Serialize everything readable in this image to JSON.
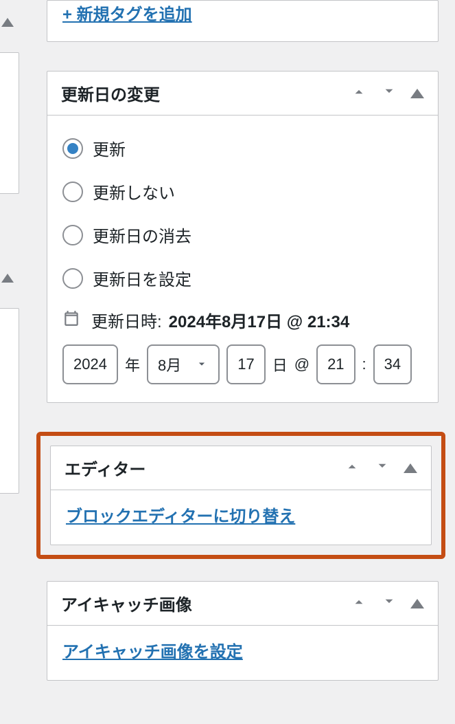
{
  "colors": {
    "accent": "#2271b1",
    "highlight_border": "#c44d14"
  },
  "tag_panel": {
    "add_tag_link": "+ 新規タグを追加"
  },
  "update_panel": {
    "title": "更新日の変更",
    "options": [
      {
        "label": "更新",
        "checked": true
      },
      {
        "label": "更新しない",
        "checked": false
      },
      {
        "label": "更新日の消去",
        "checked": false
      },
      {
        "label": "更新日を設定",
        "checked": false
      }
    ],
    "datetime_label": "更新日時:",
    "datetime_value": "2024年8月17日 @ 21:34",
    "fields": {
      "year": "2024",
      "year_suffix": "年",
      "month": "8月",
      "day": "17",
      "day_suffix": "日",
      "at": "@",
      "hour": "21",
      "sep": ":",
      "minute": "34"
    }
  },
  "editor_panel": {
    "title": "エディター",
    "link": "ブロックエディターに切り替え"
  },
  "featured_panel": {
    "title": "アイキャッチ画像",
    "link": "アイキャッチ画像を設定"
  }
}
